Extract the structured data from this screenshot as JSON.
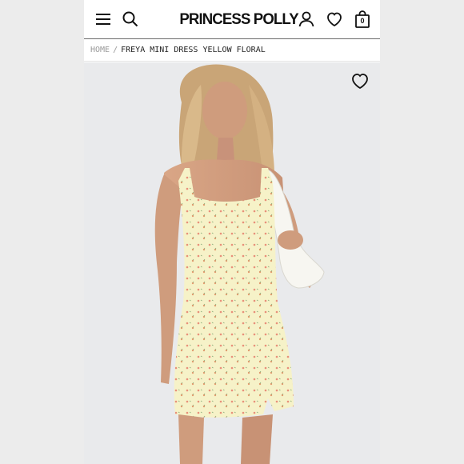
{
  "header": {
    "brand": "PRINCESS POLLY",
    "cart_count": "0",
    "icons": [
      "menu-icon",
      "search-icon",
      "account-icon",
      "heart-icon",
      "shopping-bag-icon"
    ]
  },
  "breadcrumb": {
    "home": "HOME",
    "separator": "/",
    "current": "FREYA MINI DRESS YELLOW FLORAL"
  },
  "product": {
    "wishlist_icon": "heart-outline-icon",
    "dress_color": "#f6f2c8",
    "floral_color": "#e8907a"
  }
}
